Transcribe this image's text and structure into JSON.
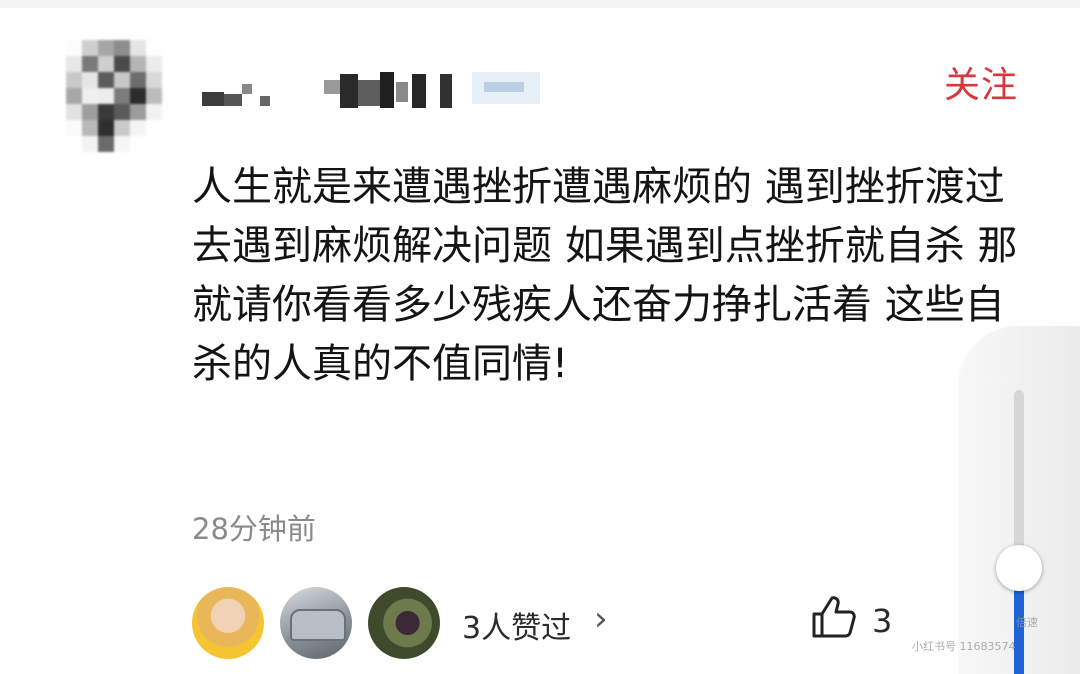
{
  "header": {
    "follow_label": "关注"
  },
  "comment": {
    "text": "人生就是来遭遇挫折遭遇麻烦的 遇到挫折渡过去遇到麻烦解决问题 如果遇到点挫折就自杀 那就请你看看多少残疾人还奋力挣扎活着 这些自杀的人真的不值同情!",
    "time": "28分钟前"
  },
  "likes": {
    "likers_label": "3人赞过",
    "chevron": "›",
    "count": "3"
  },
  "overlay": {
    "badge": "倍速",
    "footer": "小红书号 11683574"
  },
  "colors": {
    "follow": "#d9363e",
    "time": "#8a8a8a",
    "slider_fill": "#1e64d6"
  },
  "icons": [
    "thumbs-up-icon",
    "chevron-right-icon"
  ]
}
